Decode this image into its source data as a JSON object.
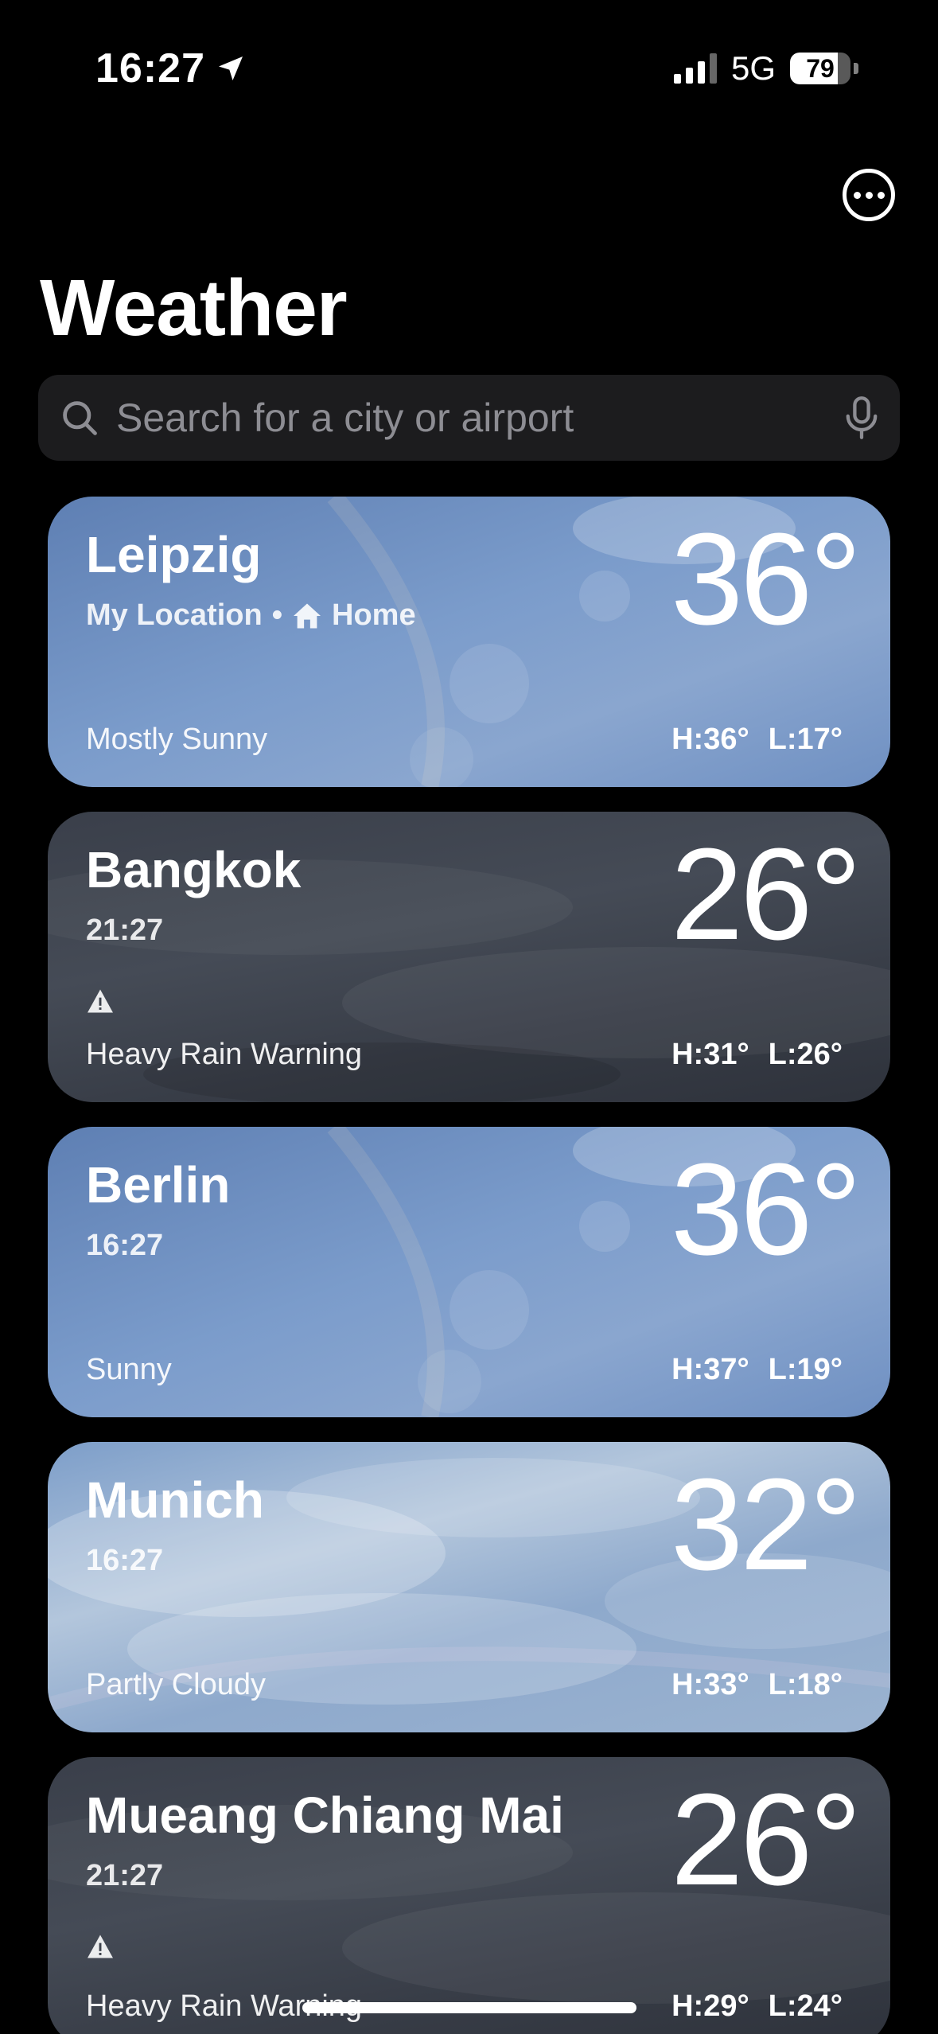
{
  "status_bar": {
    "time": "16:27",
    "network": "5G",
    "battery": "79",
    "battery_level": 0.79
  },
  "header": {
    "title": "Weather",
    "more_icon": "ellipsis-circle-icon"
  },
  "search": {
    "placeholder": "Search for a city or airport",
    "value": ""
  },
  "cities": [
    {
      "name": "Leipzig",
      "subtitle_primary": "My Location",
      "subtitle_separator": "•",
      "subtitle_secondary": "Home",
      "temperature": "36°",
      "condition": "Mostly Sunny",
      "high": "H:36°",
      "low": "L:17°",
      "theme": "sunny"
    },
    {
      "name": "Bangkok",
      "subtitle_primary": "21:27",
      "temperature": "26°",
      "condition": "Heavy Rain Warning",
      "high": "H:31°",
      "low": "L:26°",
      "theme": "rain",
      "warning": true
    },
    {
      "name": "Berlin",
      "subtitle_primary": "16:27",
      "temperature": "36°",
      "condition": "Sunny",
      "high": "H:37°",
      "low": "L:19°",
      "theme": "sunny"
    },
    {
      "name": "Munich",
      "subtitle_primary": "16:27",
      "temperature": "32°",
      "condition": "Partly Cloudy",
      "high": "H:33°",
      "low": "L:18°",
      "theme": "cloudy"
    },
    {
      "name": "Mueang Chiang Mai",
      "subtitle_primary": "21:27",
      "temperature": "26°",
      "condition": "Heavy Rain Warning",
      "high": "H:29°",
      "low": "L:24°",
      "theme": "rain",
      "warning": true
    }
  ]
}
